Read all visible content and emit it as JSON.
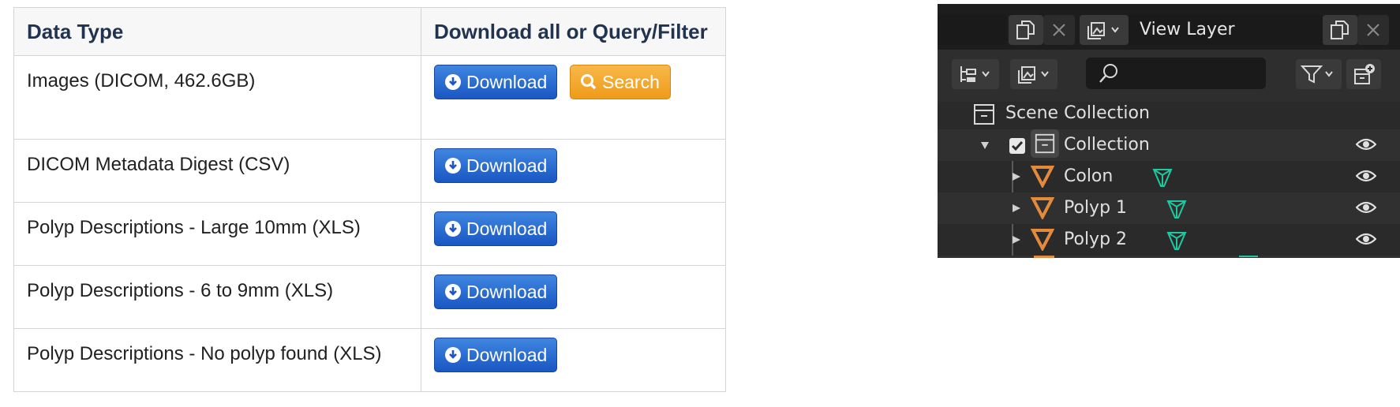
{
  "table": {
    "headers": [
      "Data Type",
      "Download all or Query/Filter"
    ],
    "rows": [
      {
        "name": "Images (DICOM, 462.6GB)",
        "download": "Download",
        "search": "Search"
      },
      {
        "name": "DICOM Metadata Digest (CSV)",
        "download": "Download"
      },
      {
        "name": "Polyp Descriptions - Large 10mm (XLS)",
        "download": "Download"
      },
      {
        "name": "Polyp Descriptions - 6 to 9mm (XLS)",
        "download": "Download"
      },
      {
        "name": "Polyp Descriptions - No polyp found (XLS)",
        "download": "Download"
      }
    ],
    "colors": {
      "download": "#1a57c2",
      "search": "#ef9b18",
      "header_text": "#223350"
    }
  },
  "outliner": {
    "view_layer": "View Layer",
    "tree": [
      {
        "label": "Scene Collection",
        "icon": "collection-icon"
      },
      {
        "label": "Collection",
        "icon": "collection-icon",
        "checked": true,
        "expanded": true
      },
      {
        "label": "Colon",
        "icon": "mesh-object-icon"
      },
      {
        "label": "Polyp 1",
        "icon": "mesh-object-icon"
      },
      {
        "label": "Polyp 2",
        "icon": "mesh-object-icon"
      }
    ],
    "colors": {
      "object": "#e48a3c",
      "mesh_data": "#1ec9a2",
      "background": "#2a2a2a"
    }
  }
}
